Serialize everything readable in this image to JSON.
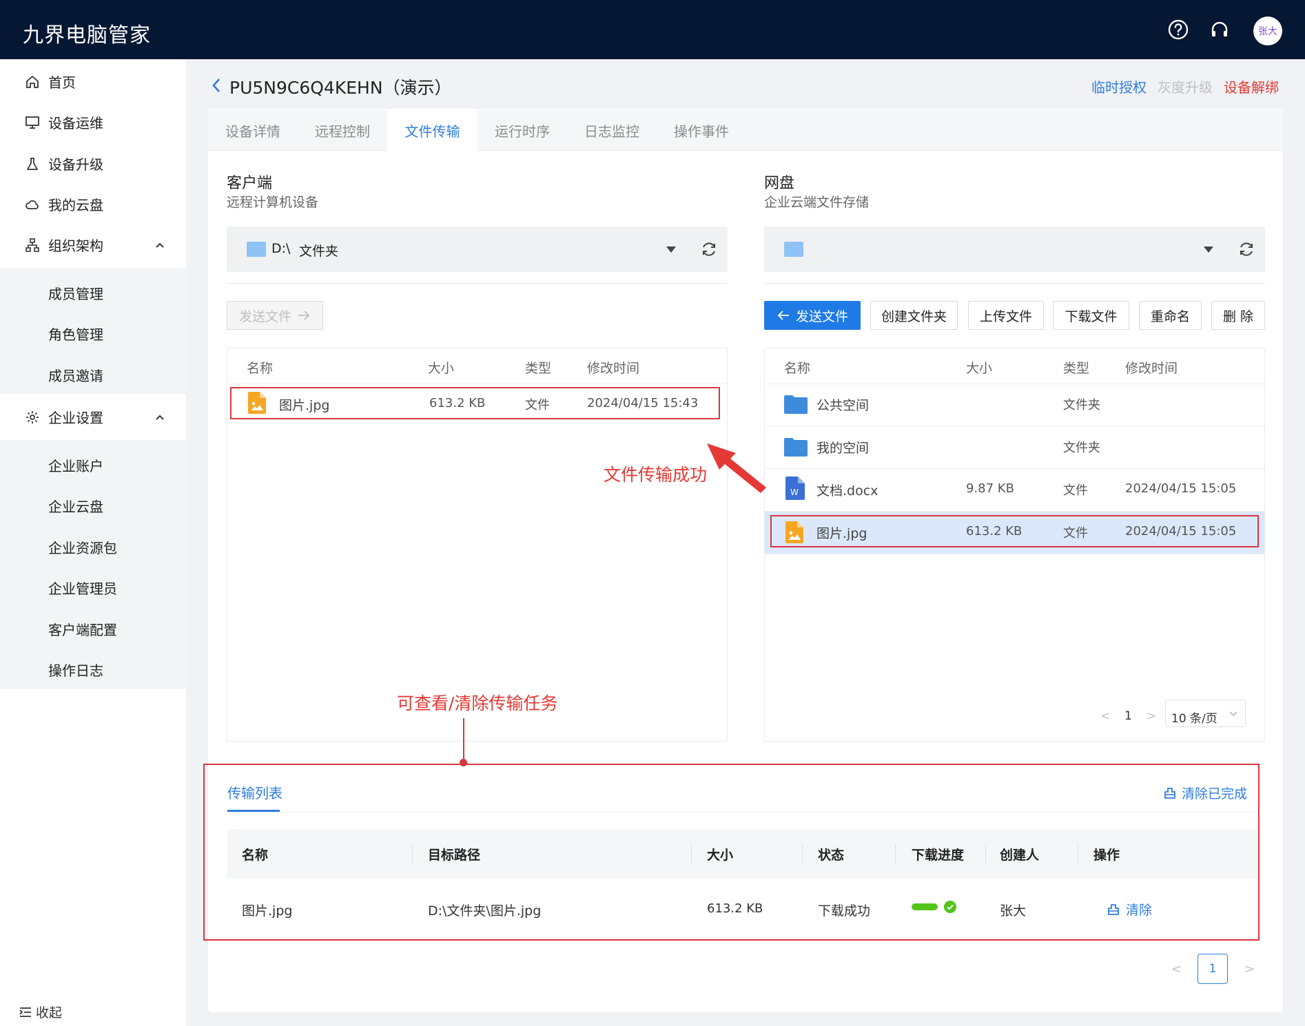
{
  "app": {
    "title": "九界电脑管家",
    "avatar_text": "张大"
  },
  "icons": {
    "help": "help-circle-icon",
    "support": "headset-icon",
    "back": "chevron-left-icon"
  },
  "colors": {
    "topbar": "#061733",
    "accent": "#2f7de1",
    "danger": "#e53935",
    "success": "#52c41a"
  },
  "sidebar": {
    "items": [
      {
        "label": "首页",
        "icon": "home-icon"
      },
      {
        "label": "设备运维",
        "icon": "monitor-icon"
      },
      {
        "label": "设备升级",
        "icon": "flask-icon"
      },
      {
        "label": "我的云盘",
        "icon": "cloud-icon"
      },
      {
        "label": "组织架构",
        "icon": "org-chart-icon"
      },
      {
        "label": "企业设置",
        "icon": "gear-icon"
      }
    ],
    "org_children": [
      "成员管理",
      "角色管理",
      "成员邀请"
    ],
    "ent_children": [
      "企业账户",
      "企业云盘",
      "企业资源包",
      "企业管理员",
      "客户端配置",
      "操作日志"
    ],
    "collapse_label": "收起"
  },
  "header": {
    "device_title": "PU5N9C6Q4KEHN（演示）",
    "links": {
      "temp_auth": "临时授权",
      "gray_upgrade": "灰度升级",
      "unbind": "设备解绑"
    }
  },
  "tabs": [
    "设备详情",
    "远程控制",
    "文件传输",
    "运行时序",
    "日志监控",
    "操作事件"
  ],
  "active_tab": "文件传输",
  "client": {
    "title": "客户端",
    "subtitle": "远程计算机设备",
    "path_drive": "D:\\",
    "path_folder": "文件夹",
    "send_button": "发送文件",
    "columns": [
      "名称",
      "大小",
      "类型",
      "修改时间"
    ],
    "files": [
      {
        "name": "图片.jpg",
        "size": "613.2 KB",
        "type": "文件",
        "modified": "2024/04/15 15:43"
      }
    ]
  },
  "cloud": {
    "title": "网盘",
    "subtitle": "企业云端文件存储",
    "path": "",
    "buttons": {
      "send": "发送文件",
      "create_folder": "创建文件夹",
      "upload": "上传文件",
      "download": "下载文件",
      "rename": "重命名",
      "delete": "删 除"
    },
    "columns": [
      "名称",
      "大小",
      "类型",
      "修改时间"
    ],
    "files": [
      {
        "name": "公共空间",
        "size": "",
        "type": "文件夹",
        "modified": ""
      },
      {
        "name": "我的空间",
        "size": "",
        "type": "文件夹",
        "modified": ""
      },
      {
        "name": "文档.docx",
        "size": "9.87 KB",
        "type": "文件",
        "modified": "2024/04/15 15:05"
      },
      {
        "name": "图片.jpg",
        "size": "613.2 KB",
        "type": "文件",
        "modified": "2024/04/15 15:05"
      }
    ],
    "pager": {
      "page": "1",
      "page_size": "10 条/页"
    }
  },
  "annotations": {
    "success": "文件传输成功",
    "transfer_hint": "可查看/清除传输任务"
  },
  "transfer": {
    "tab": "传输列表",
    "clear_done": "清除已完成",
    "columns": [
      "名称",
      "目标路径",
      "大小",
      "状态",
      "下载进度",
      "创建人",
      "操作"
    ],
    "rows": [
      {
        "name": "图片.jpg",
        "target": "D:\\文件夹\\图片.jpg",
        "size": "613.2 KB",
        "status": "下载成功",
        "progress": 1.0,
        "creator": "张大",
        "action": "清除"
      }
    ],
    "pager": {
      "page": "1"
    }
  }
}
